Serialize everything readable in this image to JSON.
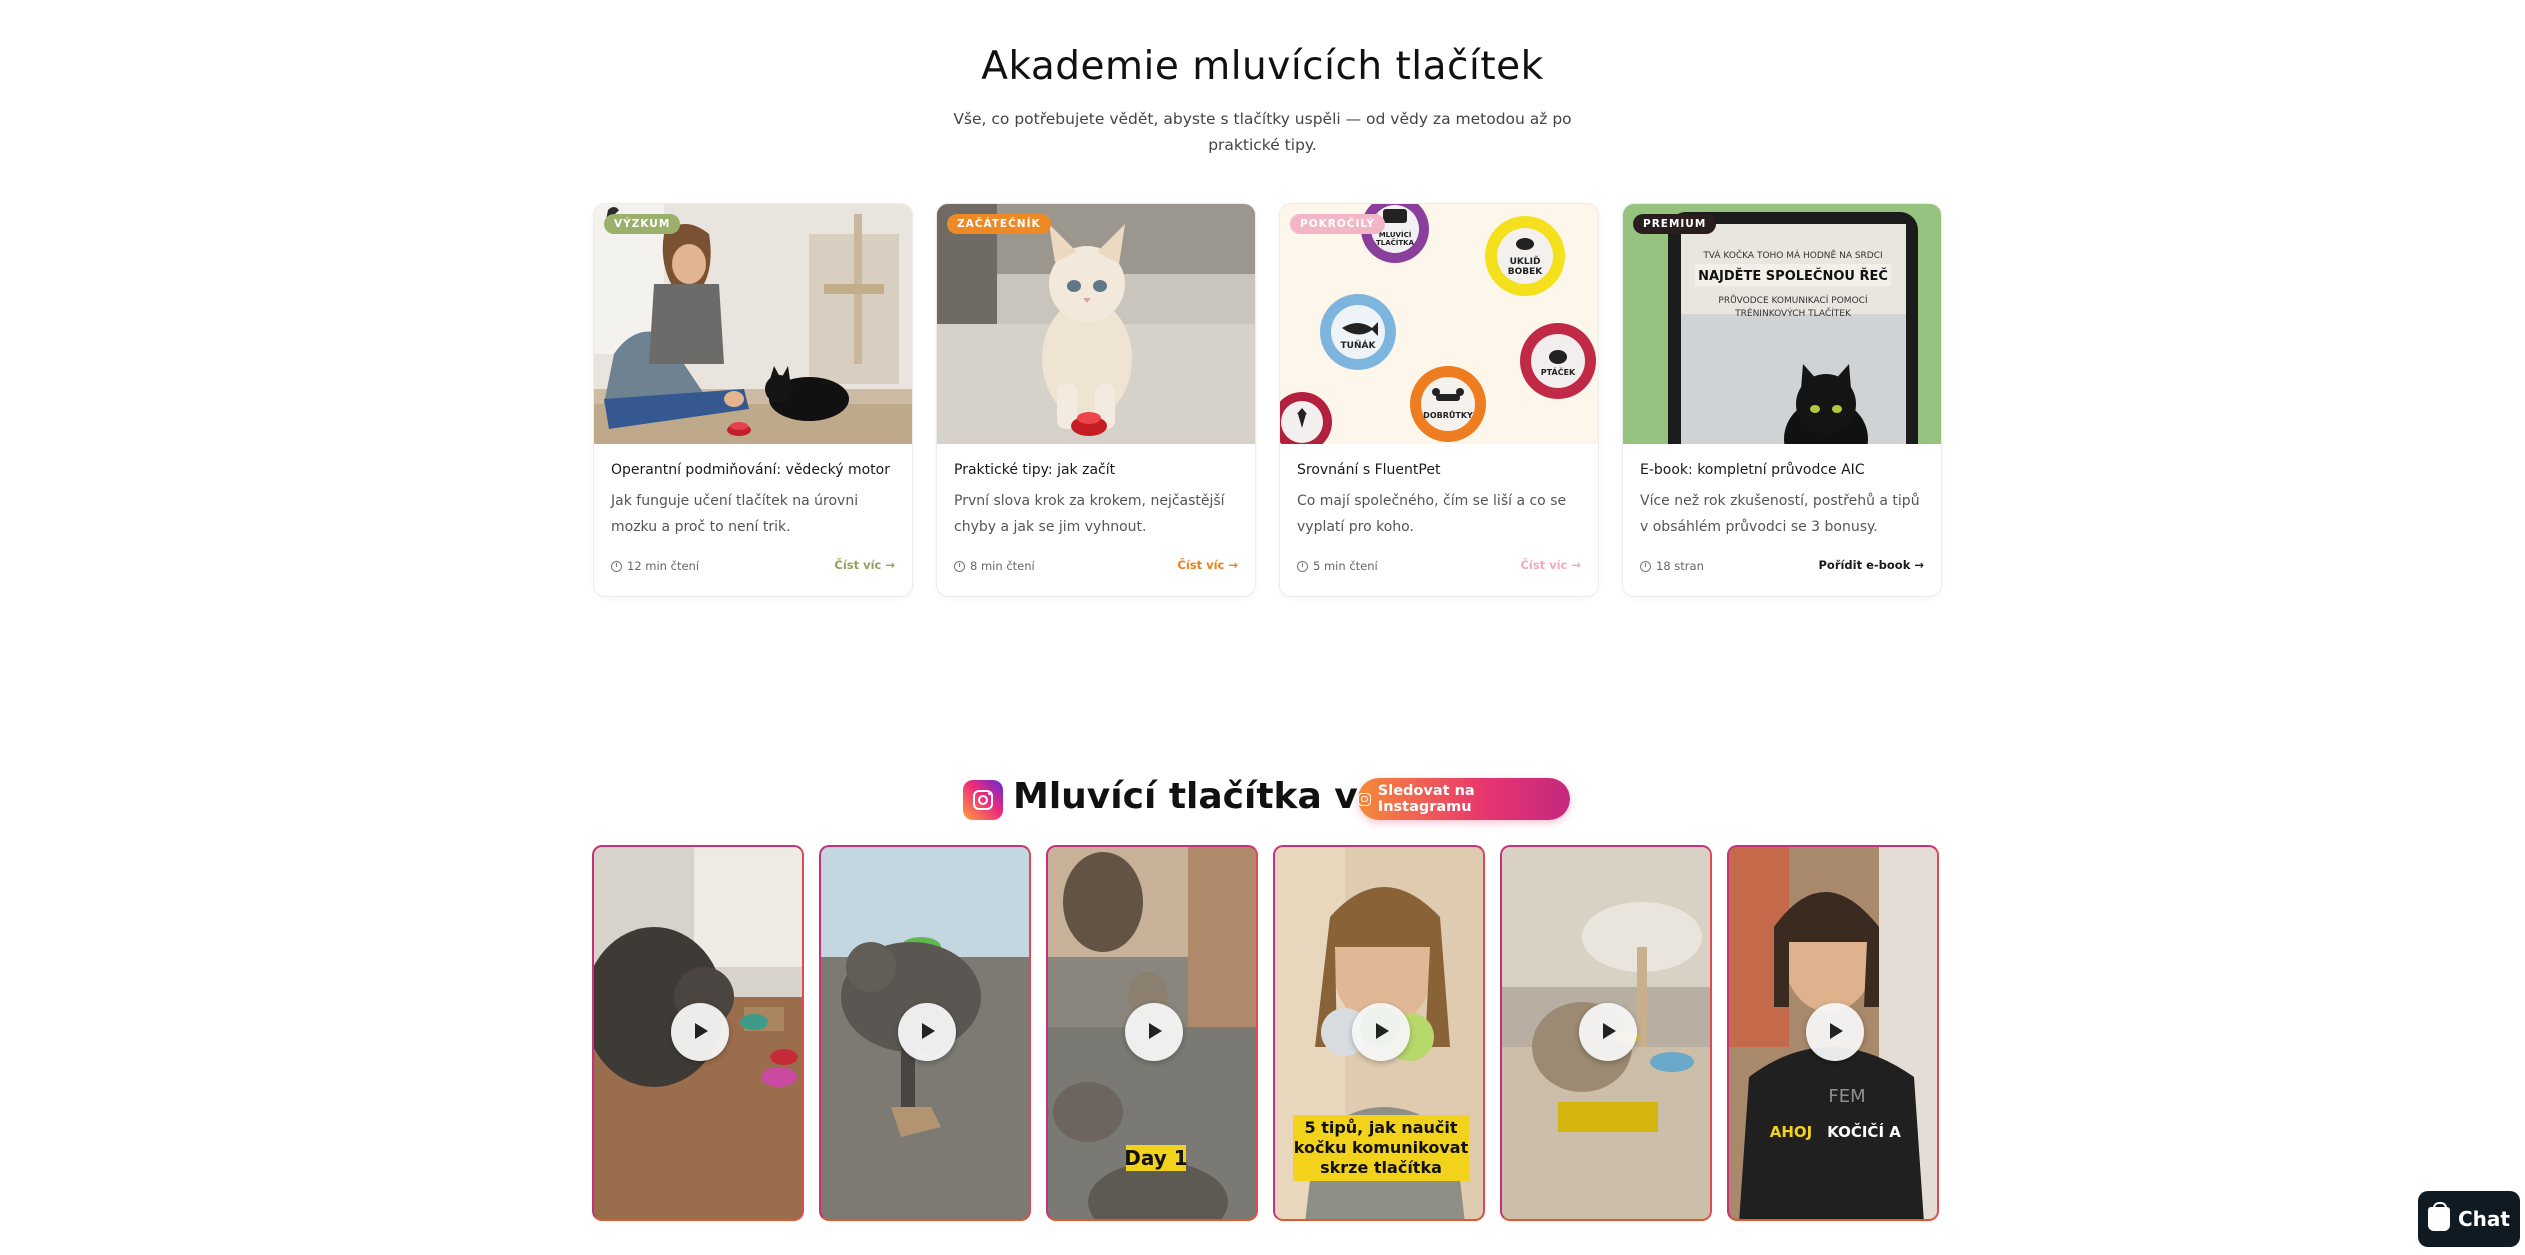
{
  "academy": {
    "title": "Akademie mluvících tlačítek",
    "subtitle_line1": "Vše, co potřebujete vědět, abyste s tlačítky uspěli — od vědy za metodou až po",
    "subtitle_line2": "praktické tipy.",
    "cards": [
      {
        "badge": "VÝZKUM",
        "badge_color": "#9bb06a",
        "title": "Operantní podmiňování: vědecký motor",
        "desc": "Jak funguje učení tlačítek na úrovni mozku a proč to není trik.",
        "meta": "12 min čtení",
        "link": "Číst víc →",
        "link_color": "#8fa35e"
      },
      {
        "badge": "ZAČÁTEČNÍK",
        "badge_color": "#ee8a26",
        "title": "Praktické tipy: jak začít",
        "desc": "První slova krok za krokem, nejčastější chyby a jak se jim vyhnout.",
        "meta": "8 min čtení",
        "link": "Číst víc →",
        "link_color": "#ea7f1e"
      },
      {
        "badge": "POKROČILÝ",
        "badge_color": "#f2b6c6",
        "title": "Srovnání s FluentPet",
        "desc": "Co mají společného, čím se liší a co se vyplatí pro koho.",
        "meta": "5 min čtení",
        "link": "Číst víc →",
        "link_color": "#f2a9bd"
      },
      {
        "badge": "PREMIUM",
        "badge_color": "#2a1d1d",
        "title": "E-book: kompletní průvodce AIC",
        "desc": "Více než rok zkušeností, postřehů a tipů v obsáhlém průvodci se 3 bonusy.",
        "meta": "18 stran",
        "link": "Pořídit e-book →",
        "link_color": "#1a1a1a"
      }
    ],
    "button_labels": {
      "tunak": "TUŇÁK",
      "uklid_1": "UKLIĎ",
      "uklid_2": "BOBEK",
      "dobrutky": "DOBRŮTKY",
      "ptacek": "PTÁČEK",
      "mluvici_1": "MLUVÍCÍ",
      "mluvici_2": "TLAČÍTKA"
    },
    "ebook": {
      "line1": "TVÁ KOČKA TOHO MÁ HODNĚ NA SRDCI",
      "line2": "NAJDĚTE SPOLEČNOU ŘEČ",
      "line3": "PRŮVODCE KOMUNIKACÍ POMOCÍ",
      "line4": "TRÉNINKOVÝCH TLAČÍTEK"
    }
  },
  "instagram": {
    "title": "Mluvící tlačítka v akci",
    "follow_label": "Sledovat na Instagramu",
    "reels": [
      {
        "caption": ""
      },
      {
        "caption": ""
      },
      {
        "caption": "Day 1"
      },
      {
        "caption_line1": "5 tipů, jak naučit",
        "caption_line2": "kočku komunikovat",
        "caption_line3": "skrze tlačítka"
      },
      {
        "caption": ""
      },
      {
        "caption_yellow": "AHOJ",
        "caption_white": "KOČIČÍ A",
        "shirt": "FEM"
      }
    ]
  },
  "chat": {
    "label": "Chat"
  }
}
